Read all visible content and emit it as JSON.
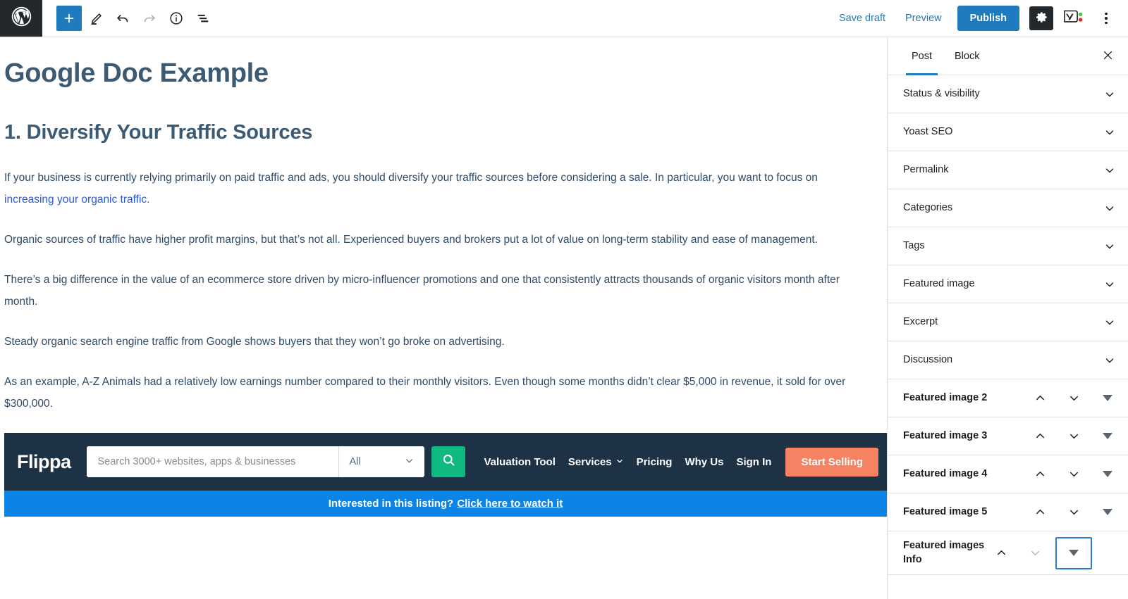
{
  "header": {
    "wp_logo": "wordpress-logo",
    "tools": [
      {
        "name": "add-block-button",
        "icon": "plus-icon",
        "label": "Add block",
        "primary": true
      },
      {
        "name": "edit-mode-button",
        "icon": "pencil-icon",
        "label": "Tools",
        "primary": false
      },
      {
        "name": "undo-button",
        "icon": "undo-icon",
        "label": "Undo",
        "primary": false
      },
      {
        "name": "redo-button",
        "icon": "redo-icon",
        "label": "Redo",
        "primary": false,
        "disabled": true
      },
      {
        "name": "details-button",
        "icon": "info-icon",
        "label": "Details",
        "primary": false
      },
      {
        "name": "list-view-button",
        "icon": "list-view-icon",
        "label": "List view",
        "primary": false
      }
    ],
    "save_draft_label": "Save draft",
    "preview_label": "Preview",
    "publish_label": "Publish",
    "settings_label": "Settings",
    "yoast_label": "Yoast SEO",
    "options_label": "Options",
    "accent_blue": "#1e7bbd",
    "yoast_dot_green": "#52c03a",
    "yoast_dot_red": "#e4262c"
  },
  "document": {
    "title": "Google Doc Example",
    "heading": "1. Diversify Your Traffic Sources",
    "heading_color": "#3d5a73",
    "body_color": "#2e4a66",
    "link_color": "#2a5bd7",
    "paragraphs": [
      {
        "before": "If your business is currently relying primarily on paid traffic and ads, you should diversify your traffic sources before considering a sale. In particular, you want to focus on ",
        "link": "increasing your organic traffic.",
        "after": ""
      },
      {
        "before": "Organic sources of traffic have higher profit margins, but that’s not all. Experienced buyers and brokers put a lot of value on long-term stability and ease of management.",
        "link": "",
        "after": ""
      },
      {
        "before": "There’s a big difference in the value of an ecommerce store driven by micro-influencer promotions and one that consistently attracts thousands of organic visitors month after month.",
        "link": "",
        "after": ""
      },
      {
        "before": "Steady organic search engine traffic from Google shows buyers that they won’t go broke on advertising.",
        "link": "",
        "after": ""
      },
      {
        "before": "As an example, A-Z Animals had a relatively low earnings number compared to their monthly visitors. Even though some months didn’t clear $5,000 in revenue, it sold for over $300,000.",
        "link": "",
        "after": ""
      }
    ]
  },
  "flippa": {
    "logo": "Flippa",
    "search_placeholder": "Search 3000+ websites, apps & businesses",
    "search_value": "",
    "category_selected": "All",
    "search_button": "search-icon",
    "nav": [
      {
        "label": "Valuation Tool",
        "has_caret": false
      },
      {
        "label": "Services",
        "has_caret": true
      },
      {
        "label": "Pricing",
        "has_caret": false
      },
      {
        "label": "Why Us",
        "has_caret": false
      },
      {
        "label": "Sign In",
        "has_caret": false
      }
    ],
    "cta_button": "Start Selling",
    "bottom_bar_text": "Interested in this listing?",
    "bottom_bar_link": "Click here to watch it",
    "bar_bg": "#1e3246",
    "search_btn_bg": "#10b981",
    "cta_bg": "#f58263",
    "bottom_bar_bg": "#0b84e8"
  },
  "sidebar": {
    "tabs": [
      {
        "label": "Post",
        "active": true
      },
      {
        "label": "Block",
        "active": false
      }
    ],
    "close_label": "Close settings",
    "panels": [
      {
        "title": "Status & visibility",
        "type": "collapse"
      },
      {
        "title": "Yoast SEO",
        "type": "collapse"
      },
      {
        "title": "Permalink",
        "type": "collapse"
      },
      {
        "title": "Categories",
        "type": "collapse"
      },
      {
        "title": "Tags",
        "type": "collapse"
      },
      {
        "title": "Featured image",
        "type": "collapse"
      },
      {
        "title": "Excerpt",
        "type": "collapse"
      },
      {
        "title": "Discussion",
        "type": "collapse"
      },
      {
        "title": "Featured image 2",
        "type": "meta",
        "up": true,
        "down": true,
        "toggle_focused": false
      },
      {
        "title": "Featured image 3",
        "type": "meta",
        "up": true,
        "down": true,
        "toggle_focused": false
      },
      {
        "title": "Featured image 4",
        "type": "meta",
        "up": true,
        "down": true,
        "toggle_focused": false
      },
      {
        "title": "Featured image 5",
        "type": "meta",
        "up": true,
        "down": true,
        "toggle_focused": false
      },
      {
        "title": "Featured images Info",
        "type": "meta",
        "up": true,
        "down": false,
        "toggle_focused": true
      }
    ]
  }
}
